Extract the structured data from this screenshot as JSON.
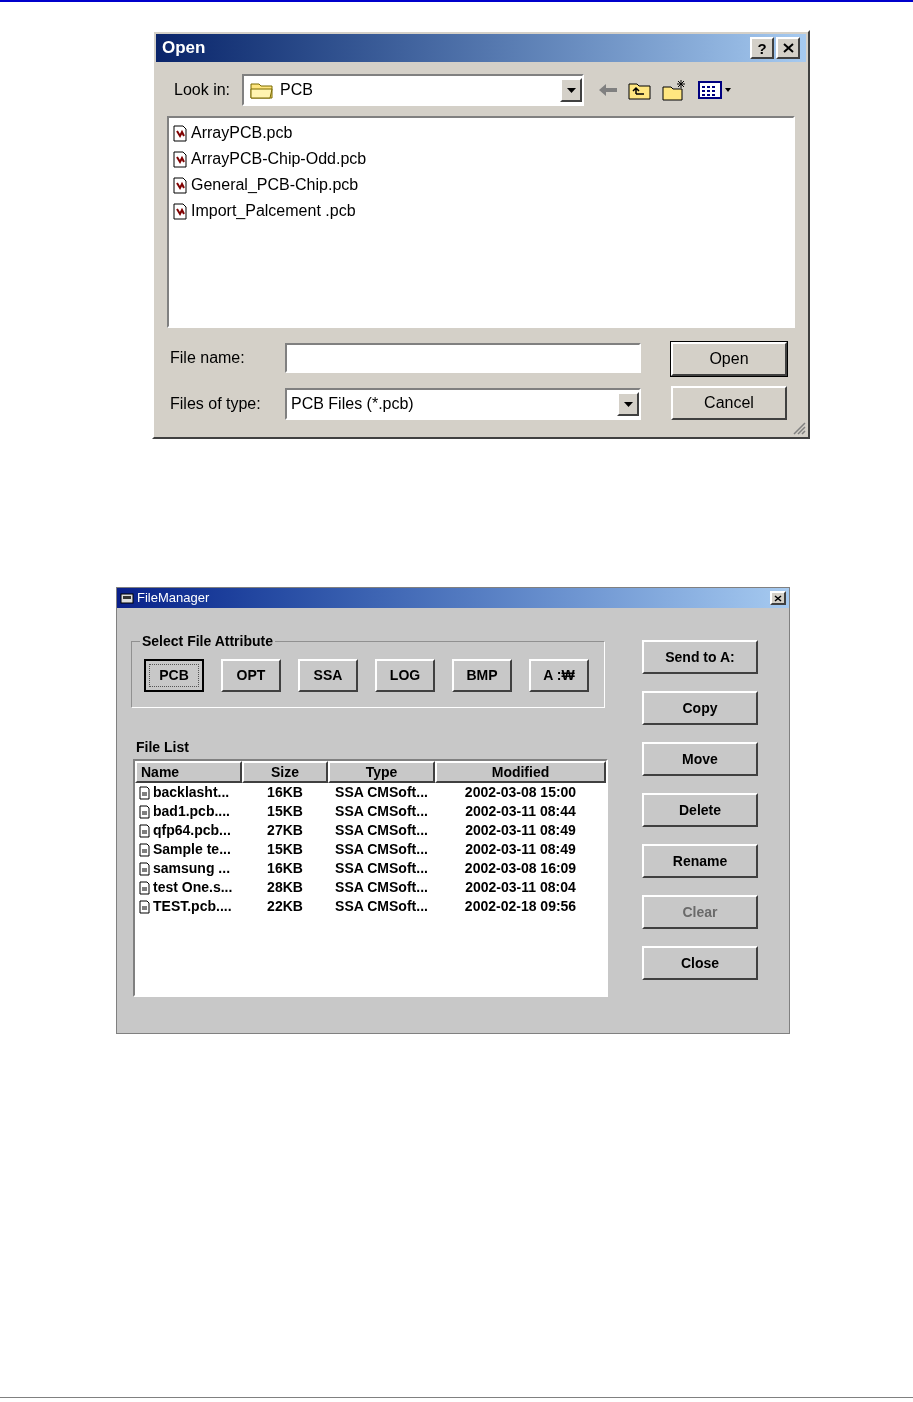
{
  "open_dialog": {
    "title": "Open",
    "help_glyph": "?",
    "look_in": {
      "label": "Look in:",
      "value": "PCB"
    },
    "files": [
      "ArrayPCB.pcb",
      "ArrayPCB-Chip-Odd.pcb",
      "General_PCB-Chip.pcb",
      "Import_Palcement .pcb"
    ],
    "file_name": {
      "label": "File name:"
    },
    "files_of_type": {
      "label": "Files of type:",
      "value": "PCB Files (*.pcb)"
    },
    "buttons": [
      {
        "label": "Open",
        "default": true
      },
      {
        "label": "Cancel",
        "default": false
      }
    ]
  },
  "file_manager": {
    "title": "FileManager",
    "attribute_group": {
      "title": "Select File Attribute",
      "buttons": [
        {
          "label": "PCB",
          "selected": true
        },
        {
          "label": "OPT",
          "selected": false
        },
        {
          "label": "SSA",
          "selected": false
        },
        {
          "label": "LOG",
          "selected": false
        },
        {
          "label": "BMP",
          "selected": false
        },
        {
          "label": "A :₩",
          "selected": false
        }
      ]
    },
    "file_list": {
      "title": "File List",
      "columns": [
        "Name",
        "Size",
        "Type",
        "Modified"
      ],
      "rows": [
        {
          "name": "backlasht...",
          "size": "16KB",
          "type": "SSA CMSoft...",
          "modified": "2002-03-08 15:00"
        },
        {
          "name": "bad1.pcb....",
          "size": "15KB",
          "type": "SSA CMSoft...",
          "modified": "2002-03-11 08:44"
        },
        {
          "name": "qfp64.pcb...",
          "size": "27KB",
          "type": "SSA CMSoft...",
          "modified": "2002-03-11 08:49"
        },
        {
          "name": "Sample te...",
          "size": "15KB",
          "type": "SSA CMSoft...",
          "modified": "2002-03-11 08:49"
        },
        {
          "name": "samsung ...",
          "size": "16KB",
          "type": "SSA CMSoft...",
          "modified": "2002-03-08 16:09"
        },
        {
          "name": "test One.s...",
          "size": "28KB",
          "type": "SSA CMSoft...",
          "modified": "2002-03-11 08:04"
        },
        {
          "name": "TEST.pcb....",
          "size": "22KB",
          "type": "SSA CMSoft...",
          "modified": "2002-02-18 09:56"
        }
      ]
    },
    "actions": [
      {
        "label": "Send to A:",
        "disabled": false
      },
      {
        "label": "Copy",
        "disabled": false
      },
      {
        "label": "Move",
        "disabled": false
      },
      {
        "label": "Delete",
        "disabled": false
      },
      {
        "label": "Rename",
        "disabled": false
      },
      {
        "label": "Clear",
        "disabled": true
      },
      {
        "label": "Close",
        "disabled": false
      }
    ]
  }
}
